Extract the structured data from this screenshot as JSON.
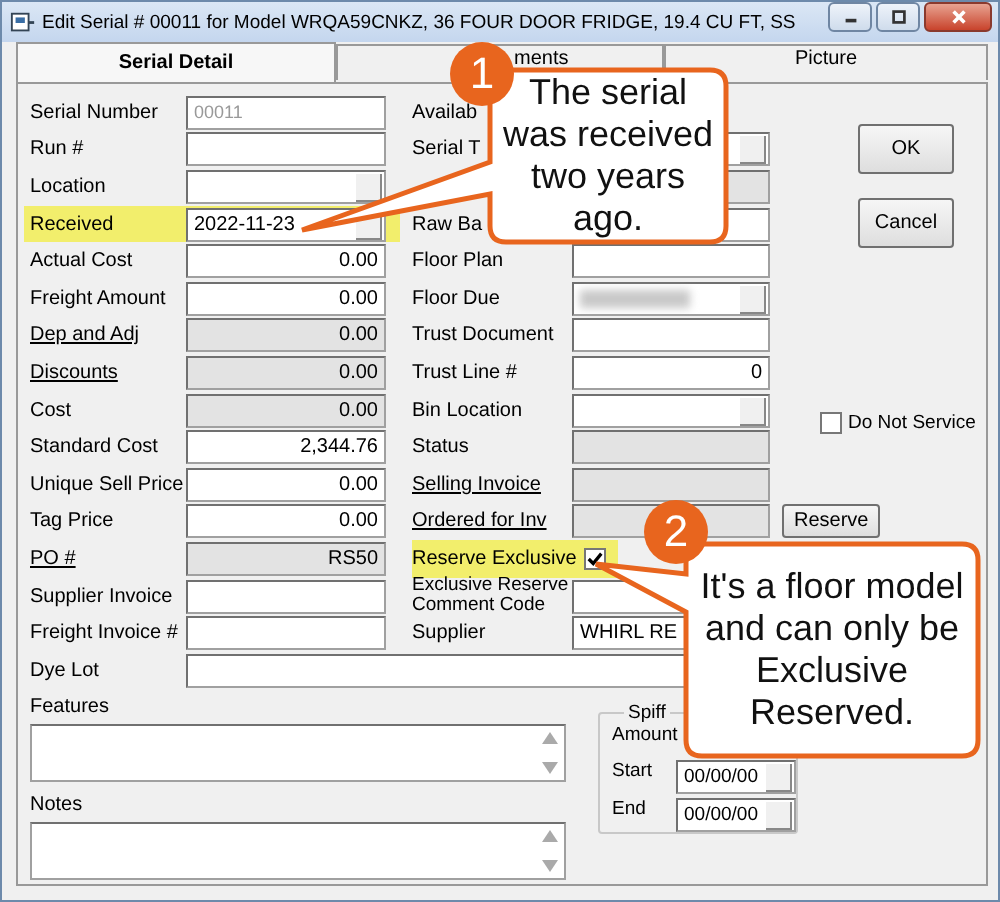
{
  "window": {
    "title": "Edit Serial # 00011 for Model WRQA59CNKZ, 36 FOUR DOOR FRIDGE, 19.4 CU FT, SS"
  },
  "tabs": [
    {
      "label": "Serial Detail",
      "selected": true
    },
    {
      "label": "ments",
      "selected": false
    },
    {
      "label": "Picture",
      "selected": false
    }
  ],
  "left_fields": [
    {
      "label": "Serial Number",
      "kind": "text",
      "placeholder": "00011",
      "readonly": false,
      "underlined": false,
      "highlighted": false
    },
    {
      "label": "Run #",
      "kind": "text",
      "readonly": false,
      "underlined": false,
      "highlighted": false
    },
    {
      "label": "Location",
      "kind": "dropdown",
      "readonly": false,
      "underlined": false,
      "highlighted": false
    },
    {
      "label": "Received",
      "kind": "dropdown",
      "value": "2022-11-23",
      "readonly": false,
      "underlined": false,
      "highlighted": true
    },
    {
      "label": "Actual Cost",
      "kind": "number",
      "value": "0.00",
      "readonly": false,
      "underlined": false,
      "highlighted": false
    },
    {
      "label": "Freight Amount",
      "kind": "number",
      "value": "0.00",
      "readonly": false,
      "underlined": false,
      "highlighted": false
    },
    {
      "label": "Dep and Adj",
      "kind": "number",
      "value": "0.00",
      "readonly": true,
      "underlined": true,
      "highlighted": false
    },
    {
      "label": "Discounts",
      "kind": "number",
      "value": "0.00",
      "readonly": true,
      "underlined": true,
      "highlighted": false
    },
    {
      "label": "Cost",
      "kind": "number",
      "value": "0.00",
      "readonly": true,
      "underlined": false,
      "highlighted": false
    },
    {
      "label": "Standard Cost",
      "kind": "number",
      "value": "2,344.76",
      "readonly": false,
      "underlined": false,
      "highlighted": false
    },
    {
      "label": "Unique Sell Price",
      "kind": "number",
      "value": "0.00",
      "readonly": false,
      "underlined": false,
      "highlighted": false
    },
    {
      "label": "Tag Price",
      "kind": "number",
      "value": "0.00",
      "readonly": false,
      "underlined": false,
      "highlighted": false
    },
    {
      "label": "PO #",
      "kind": "number",
      "value": "RS50",
      "readonly": true,
      "underlined": true,
      "highlighted": false
    },
    {
      "label": "Supplier Invoice",
      "kind": "text",
      "readonly": false,
      "underlined": false,
      "highlighted": false
    },
    {
      "label": "Freight Invoice #",
      "kind": "text",
      "readonly": false,
      "underlined": false,
      "highlighted": false
    }
  ],
  "right_fields": [
    {
      "label": "Availab",
      "kind": "none",
      "underlined": false,
      "highlighted": false
    },
    {
      "label": "Serial T",
      "kind": "dropdown",
      "readonly": false,
      "underlined": false,
      "highlighted": false
    },
    {
      "kind": "text",
      "readonly": true,
      "highlighted": false
    },
    {
      "label": "Raw Ba",
      "kind": "text",
      "readonly": false,
      "underlined": false,
      "highlighted": false
    },
    {
      "label": "Floor Plan",
      "kind": "text",
      "readonly": false,
      "underlined": false,
      "highlighted": false
    },
    {
      "label": "Floor Due",
      "kind": "blurred",
      "readonly": false,
      "underlined": false,
      "highlighted": false
    },
    {
      "label": "Trust Document",
      "kind": "text",
      "readonly": false,
      "underlined": false,
      "highlighted": false
    },
    {
      "label": "Trust Line #",
      "kind": "number",
      "value": "0",
      "readonly": false,
      "underlined": false,
      "highlighted": false
    },
    {
      "label": "Bin Location",
      "kind": "dropdown",
      "readonly": false,
      "underlined": false,
      "highlighted": false
    },
    {
      "label": "Status",
      "kind": "text",
      "readonly": true,
      "underlined": false,
      "highlighted": false
    },
    {
      "label": "Selling Invoice",
      "kind": "text",
      "readonly": true,
      "underlined": true,
      "highlighted": false
    },
    {
      "label": "Ordered for Inv",
      "kind": "text",
      "action": "Reserve",
      "readonly": true,
      "underlined": true,
      "highlighted": false
    },
    {
      "label": "Reserve Exclusive",
      "kind": "checkbox",
      "checked": true,
      "underlined": false,
      "highlighted": true
    },
    {
      "label": "Exclusive Reserve Comment Code",
      "kind": "text",
      "readonly": false,
      "underlined": false,
      "highlighted": false
    },
    {
      "label": "Supplier",
      "kind": "text",
      "value": "WHIRL RE",
      "readonly": false,
      "underlined": false,
      "highlighted": false
    }
  ],
  "buttons": [
    "OK",
    "Cancel"
  ],
  "do_not_service": {
    "label": "Do Not Service",
    "checked": false
  },
  "dye_lot": {
    "label": "Dye Lot"
  },
  "features": {
    "label": "Features"
  },
  "notes": {
    "label": "Notes"
  },
  "spiff": {
    "title": "Spiff",
    "amount_label": "Amount",
    "start": {
      "label": "Start",
      "value": "00/00/00"
    },
    "end": {
      "label": "End",
      "value": "00/00/00"
    }
  },
  "callouts": [
    {
      "number": "1",
      "text": "The serial was received two years ago."
    },
    {
      "number": "2",
      "text": "It's a floor model and can only be Exclusive Reserved."
    }
  ]
}
